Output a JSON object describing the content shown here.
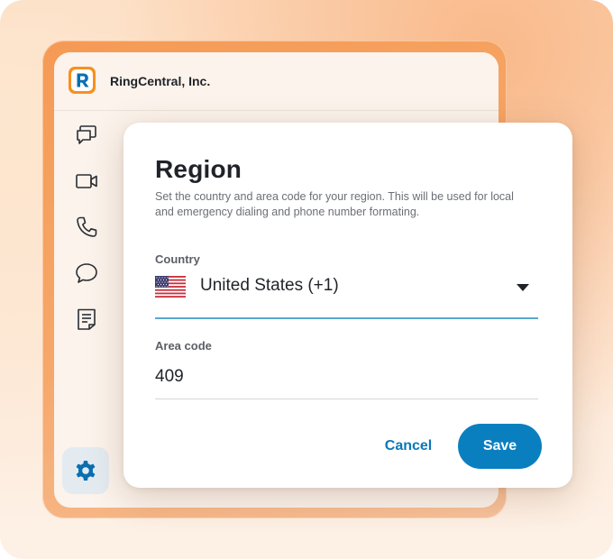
{
  "app": {
    "company_name": "RingCentral, Inc.",
    "logo_icon": "ringcentral-logo",
    "brand_color": "#f7901e",
    "accent_color": "#0a7fc0"
  },
  "sidebar": {
    "items": [
      {
        "icon": "messages-icon"
      },
      {
        "icon": "video-icon"
      },
      {
        "icon": "phone-icon"
      },
      {
        "icon": "chat-icon"
      },
      {
        "icon": "notes-icon"
      }
    ],
    "settings_icon": "gear-icon"
  },
  "dialog": {
    "title": "Region",
    "description": "Set the country and area code for your region. This will be used for local and emergency dialing and phone number formating.",
    "country": {
      "label": "Country",
      "value": "United States (+1)",
      "flag_icon": "us-flag-icon"
    },
    "area_code": {
      "label": "Area code",
      "value": "409"
    },
    "buttons": {
      "cancel": "Cancel",
      "save": "Save"
    }
  }
}
